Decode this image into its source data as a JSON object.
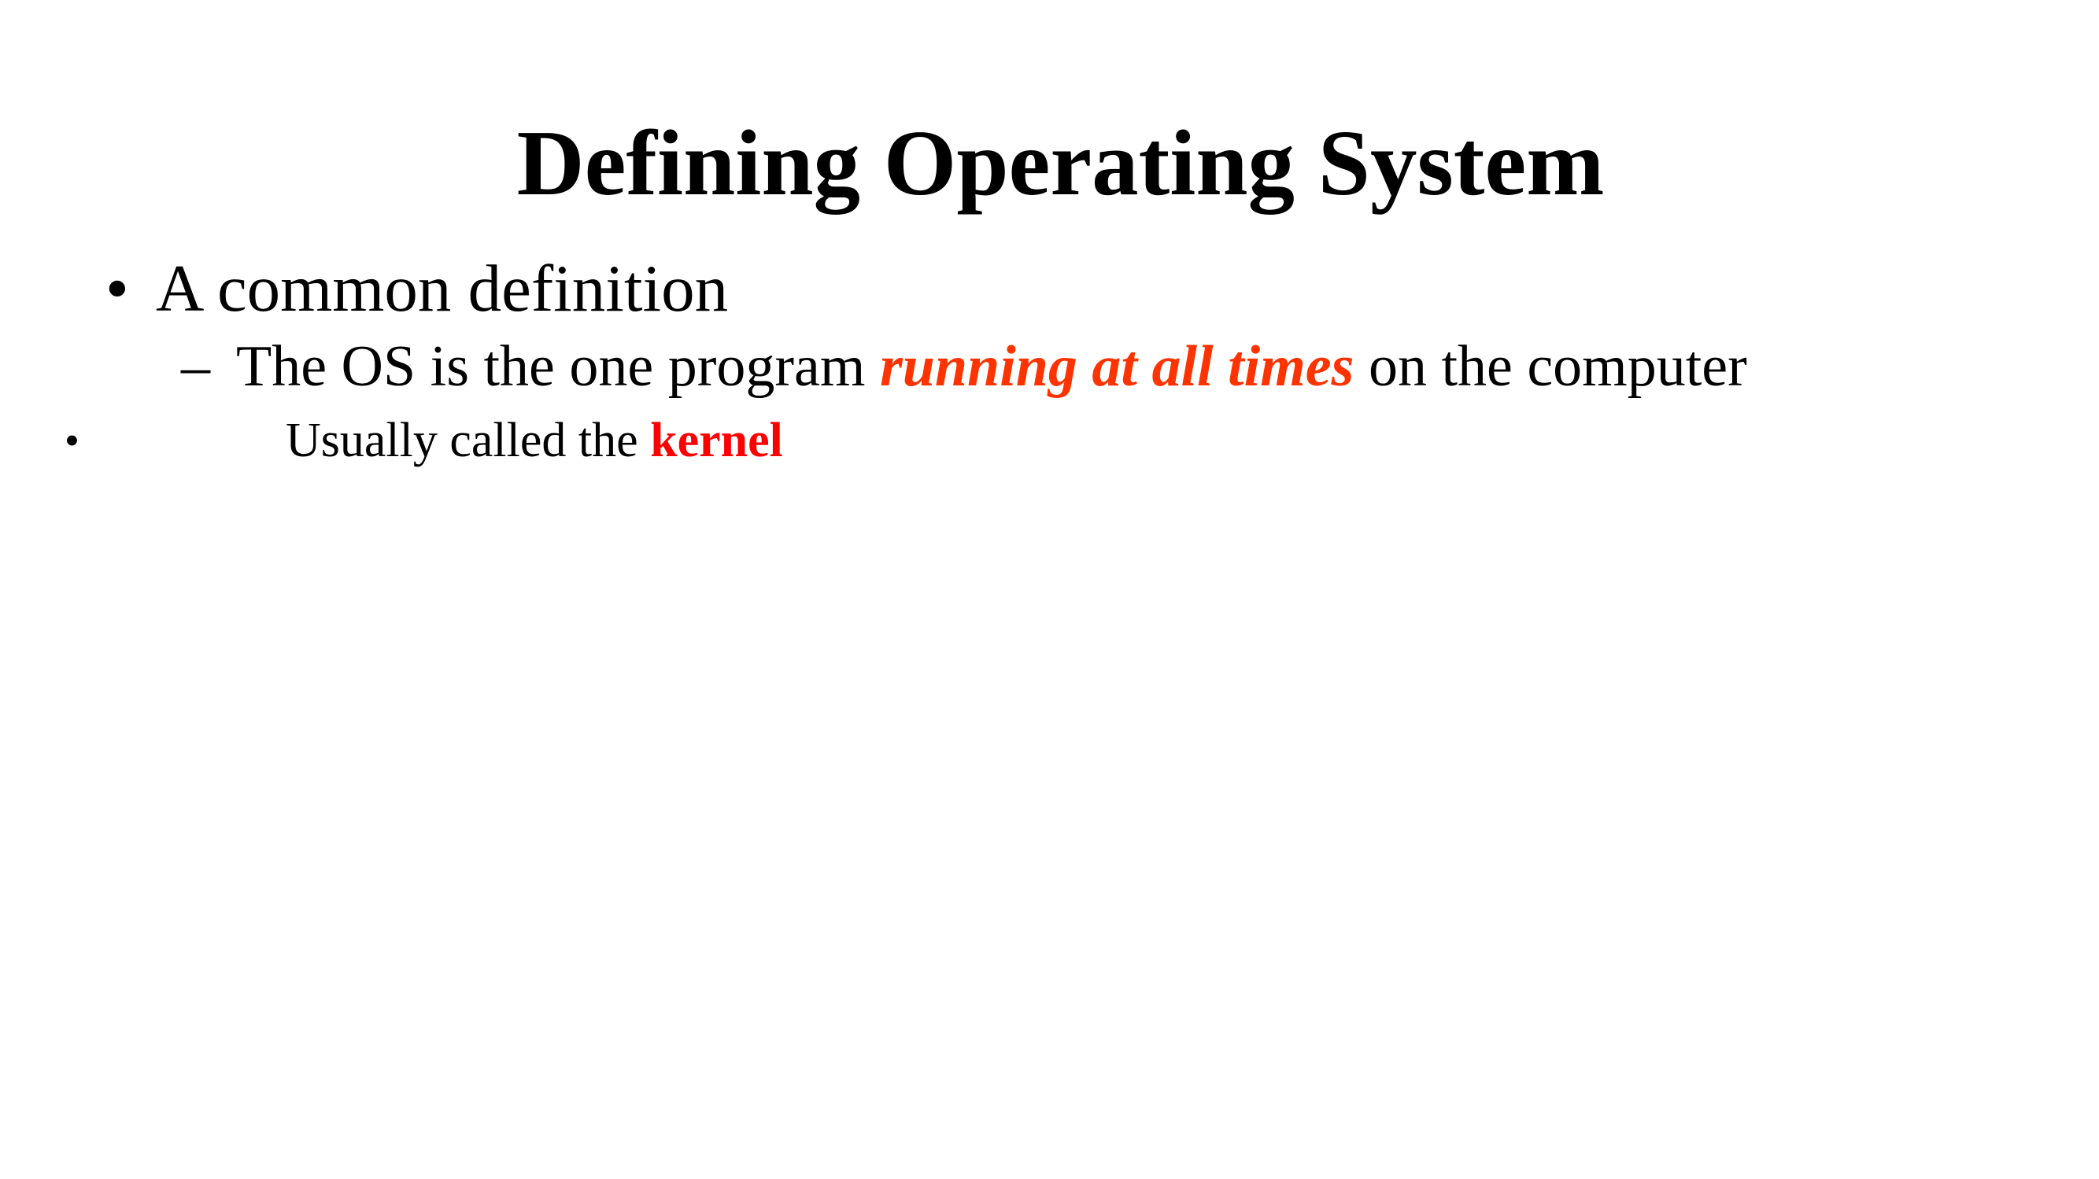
{
  "slide": {
    "title": "Defining Operating System",
    "bullets": [
      {
        "marker": "•",
        "text": "A common definition"
      },
      {
        "marker": "–",
        "prefix": "The OS is the one program ",
        "emphasis": "running at all times",
        "suffix": " on the computer"
      },
      {
        "marker": "•",
        "prefix": "Usually called the ",
        "emphasis": "kernel"
      }
    ]
  },
  "colors": {
    "emphasis_running": "#ff3300",
    "emphasis_kernel": "#ff0000",
    "text": "#000000",
    "background": "#ffffff"
  }
}
